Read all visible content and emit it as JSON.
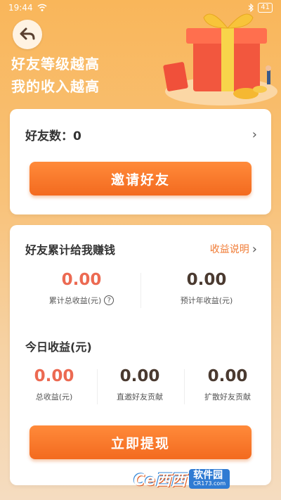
{
  "status_bar": {
    "time": "19:44",
    "battery": "41"
  },
  "hero": {
    "line1": "好友等级越高",
    "line2": "我的收入越高"
  },
  "friends_card": {
    "label": "好友数：0",
    "invite_button": "邀请好友"
  },
  "earnings_card": {
    "title": "好友累计给我赚钱",
    "link": "收益说明",
    "total": {
      "value": "0.00",
      "label": "累计总收益(元)"
    },
    "annual": {
      "value": "0.00",
      "label": "预计年收益(元)"
    },
    "today_title": "今日收益(元)",
    "today_total": {
      "value": "0.00",
      "label": "总收益(元)"
    },
    "direct": {
      "value": "0.00",
      "label": "直邀好友贡献"
    },
    "spread": {
      "value": "0.00",
      "label": "扩散好友贡献"
    },
    "withdraw_button": "立即提现"
  },
  "watermark": {
    "logo": "Ce西西",
    "name": "软件园",
    "url": "CR173.com"
  },
  "colors": {
    "accent": "#f36a1f",
    "value_red": "#ec6a52"
  }
}
